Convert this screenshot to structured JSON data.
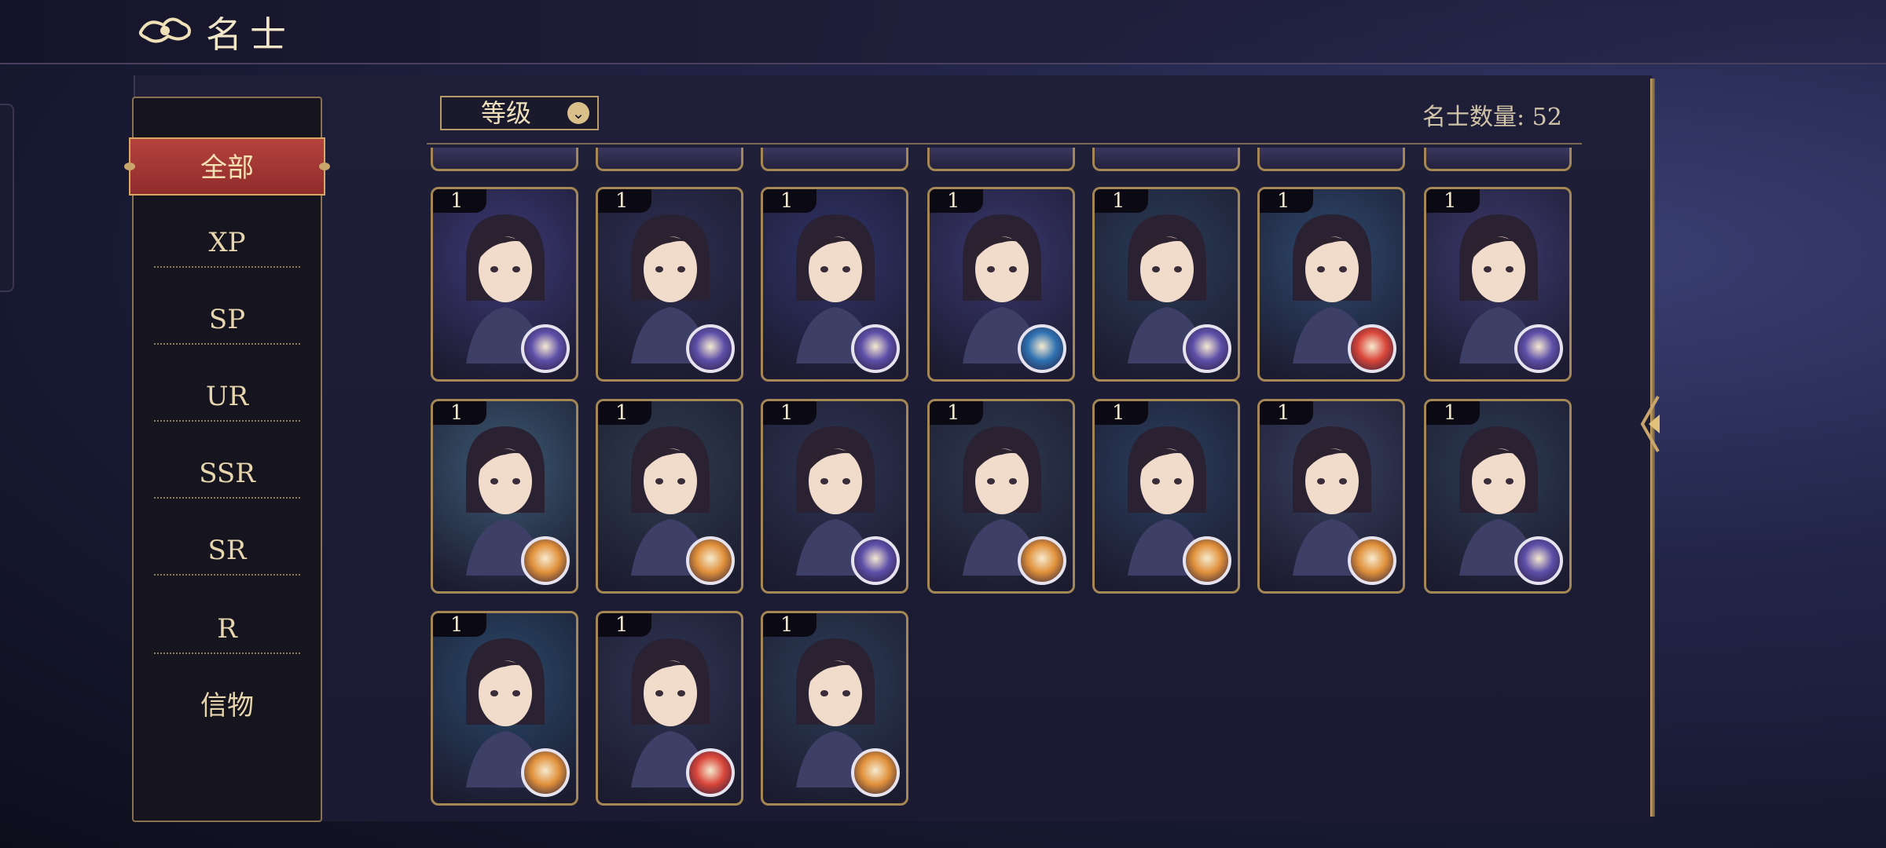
{
  "header": {
    "title": "名士"
  },
  "sidebar": {
    "items": [
      {
        "label": "全部",
        "active": true
      },
      {
        "label": "XP"
      },
      {
        "label": "SP"
      },
      {
        "label": "UR"
      },
      {
        "label": "SSR"
      },
      {
        "label": "SR"
      },
      {
        "label": "R"
      },
      {
        "label": "信物"
      }
    ]
  },
  "toolbar": {
    "filter_label": "等级",
    "count_text": "名士数量: 52"
  },
  "colors": {
    "accent_gold": "#c9a66b",
    "active_red": "#a13736",
    "badge_purple": "#5e4fa8",
    "badge_orange": "#e0903a",
    "badge_red": "#d9463a",
    "badge_blue": "#2f72b2"
  },
  "cards": [
    {
      "level": "1",
      "badge": "purple-emblem-icon",
      "bg": "#3d3a78"
    },
    {
      "level": "1",
      "badge": "purple-emblem-icon",
      "bg": "#2d2f52"
    },
    {
      "level": "1",
      "badge": "purple-emblem-icon",
      "bg": "#30346a"
    },
    {
      "level": "1",
      "badge": "blue-emblem-icon",
      "bg": "#3a3870"
    },
    {
      "level": "1",
      "badge": "purple-emblem-icon",
      "bg": "#2b3d58"
    },
    {
      "level": "1",
      "badge": "red-emblem-icon",
      "bg": "#2f4a6e"
    },
    {
      "level": "1",
      "badge": "purple-emblem-icon",
      "bg": "#3c3a6e"
    },
    {
      "level": "1",
      "badge": "orange-emblem-icon",
      "bg": "#3c5a74"
    },
    {
      "level": "1",
      "badge": "orange-emblem-icon",
      "bg": "#2e3d4e"
    },
    {
      "level": "1",
      "badge": "purple-emblem-icon",
      "bg": "#2d3452"
    },
    {
      "level": "1",
      "badge": "orange-emblem-icon",
      "bg": "#2d3a50"
    },
    {
      "level": "1",
      "badge": "orange-emblem-icon",
      "bg": "#2c3f5e"
    },
    {
      "level": "1",
      "badge": "orange-emblem-icon",
      "bg": "#384060"
    },
    {
      "level": "1",
      "badge": "purple-emblem-icon",
      "bg": "#2c3c54"
    },
    {
      "level": "1",
      "badge": "orange-emblem-icon",
      "bg": "#2a4a6a"
    },
    {
      "level": "1",
      "badge": "red-emblem-icon",
      "bg": "#2f3552"
    },
    {
      "level": "1",
      "badge": "orange-emblem-icon",
      "bg": "#2c3d56"
    }
  ]
}
